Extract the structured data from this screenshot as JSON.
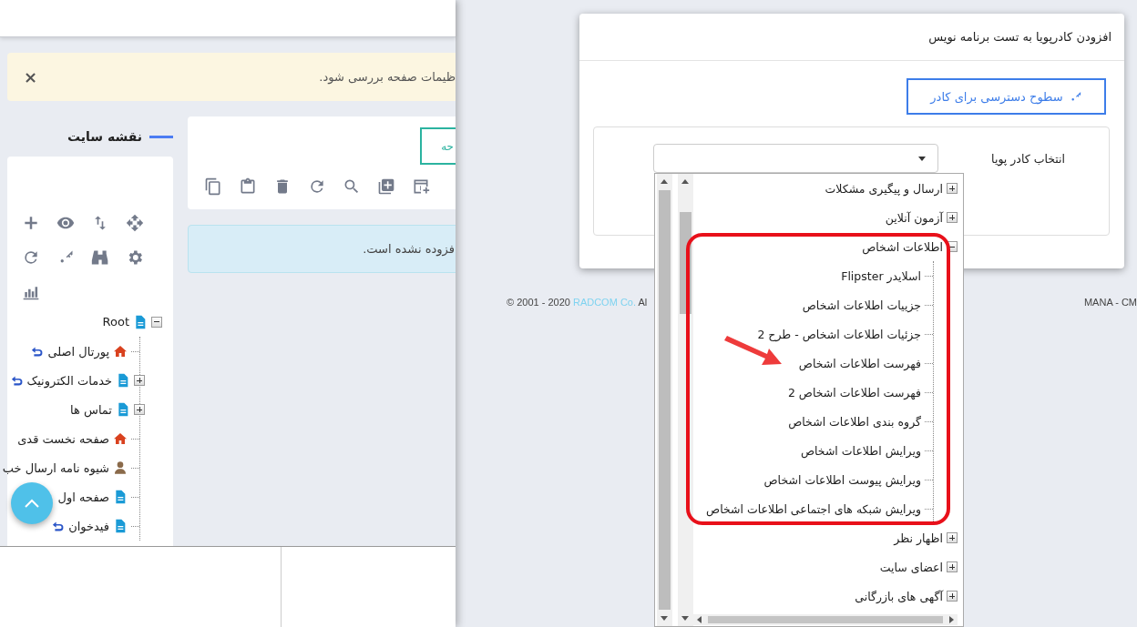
{
  "alert": {
    "message": "ظیمات صفحه بررسی شود.",
    "close": "×"
  },
  "sitemap": {
    "title": "نقشه سایت",
    "tree": [
      {
        "label": "Root",
        "kind": "page",
        "expanded": true,
        "linked": false,
        "children": [
          {
            "label": "پورتال اصلی",
            "kind": "home",
            "linked": true
          },
          {
            "label": "خدمات الکترونیک",
            "kind": "page",
            "expanded": false,
            "linked": true
          },
          {
            "label": "تماس ها",
            "kind": "page",
            "expanded": false,
            "linked": false
          },
          {
            "label": "صفحه نخست قدی",
            "kind": "home",
            "linked": false
          },
          {
            "label": "شیوه نامه ارسال خب",
            "kind": "user",
            "linked": false
          },
          {
            "label": "صفحه اول",
            "kind": "page",
            "linked": false
          },
          {
            "label": "فیدخوان",
            "kind": "page",
            "linked": true
          }
        ]
      }
    ]
  },
  "page_panel": {
    "tab": "حه",
    "info": "فزوده نشده است."
  },
  "footer": {
    "copyright": "© 2001 - 2020 ",
    "company": "RADCOM Co.",
    "copyright_end": " Al",
    "product": "MANA - CM"
  },
  "dialog": {
    "title": "افزودن کادرپویا به تست برنامه نویس",
    "access_button": "سطوح دسترسی برای کادر",
    "field_label": "انتخاب کادر پویا",
    "options": [
      {
        "label": "ارسال و پیگیری مشکلات",
        "expanded": false
      },
      {
        "label": "آزمون آنلاین",
        "expanded": false
      },
      {
        "label": "اطلاعات اشخاص",
        "expanded": true,
        "children": [
          {
            "label": "اسلایدر Flipster"
          },
          {
            "label": "جزییات اطلاعات اشخاص"
          },
          {
            "label": "جزئیات اطلاعات اشخاص - طرح 2"
          },
          {
            "label": "فهرست اطلاعات اشخاص"
          },
          {
            "label": "فهرست اطلاعات اشخاص 2"
          },
          {
            "label": "گروه بندی اطلاعات اشخاص"
          },
          {
            "label": "ویرایش اطلاعات اشخاص"
          },
          {
            "label": "ویرایش پیوست اطلاعات اشخاص"
          },
          {
            "label": "ویرایش شبکه های اجتماعی اطلاعات اشخاص"
          }
        ]
      },
      {
        "label": "اظهار نظر",
        "expanded": false
      },
      {
        "label": "اعضای سایت",
        "expanded": false
      },
      {
        "label": "آگهی های بازرگانی",
        "expanded": false
      }
    ]
  }
}
